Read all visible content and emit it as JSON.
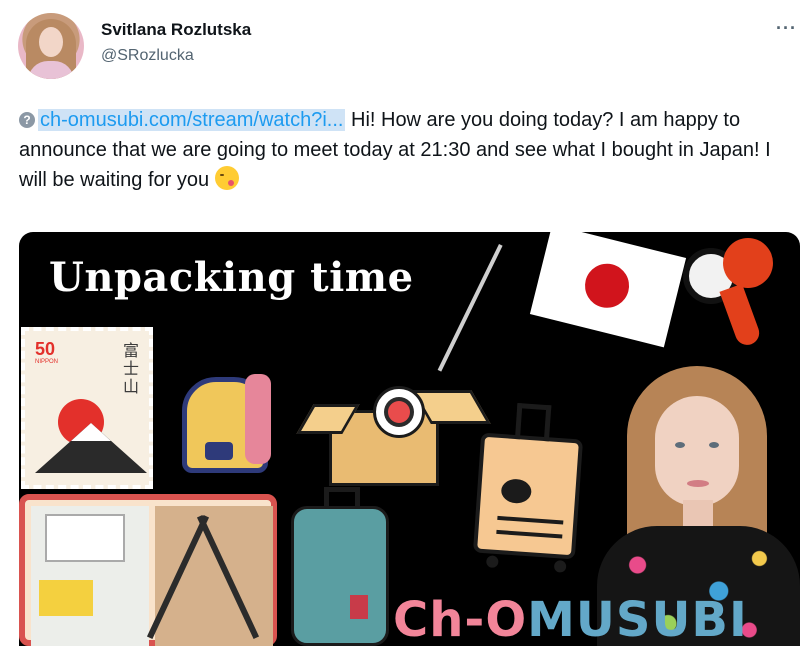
{
  "author": {
    "name": "Svitlana Rozlutska",
    "handle": "@SRozlucka"
  },
  "menu_glyph": "···",
  "tweet": {
    "link_icon": "?",
    "link_text": "ch-omusubi.com/stream/watch?i...",
    "body": " Hi! How are you doing today? I am happy to announce that we are going to meet today at 21:30 and see what I bought in Japan! I will be waiting for you ",
    "emoji": "face-savoring-food-emoji"
  },
  "media": {
    "headline": "Unpacking time",
    "stamp_value": "50",
    "stamp_country": "NIPPON",
    "stamp_kanji": "富士山",
    "brand_part1": "Ch-O",
    "brand_part2": "MUSUBI"
  },
  "colors": {
    "link": "#1d9bf0",
    "link_highlight": "#cfe3f6",
    "media_bg": "#000000"
  }
}
